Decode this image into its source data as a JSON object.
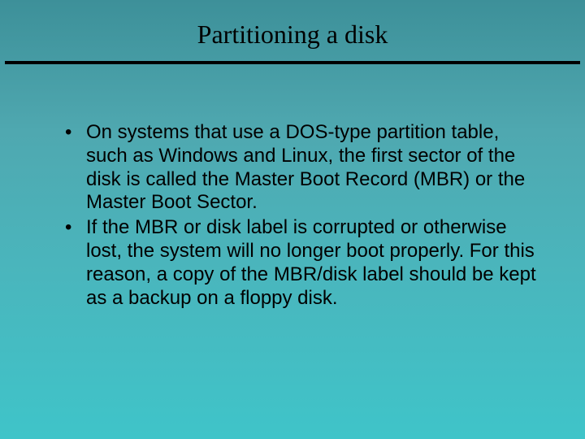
{
  "slide": {
    "title": "Partitioning a disk",
    "bullets": [
      "On systems that use a DOS-type partition table, such as Windows and Linux, the first sector of the disk is called the Master Boot Record (MBR) or the Master Boot Sector.",
      "If the MBR or disk label is corrupted or otherwise lost, the system will no longer boot properly. For this reason, a copy of the MBR/disk label should be kept as a backup on a floppy disk."
    ]
  }
}
